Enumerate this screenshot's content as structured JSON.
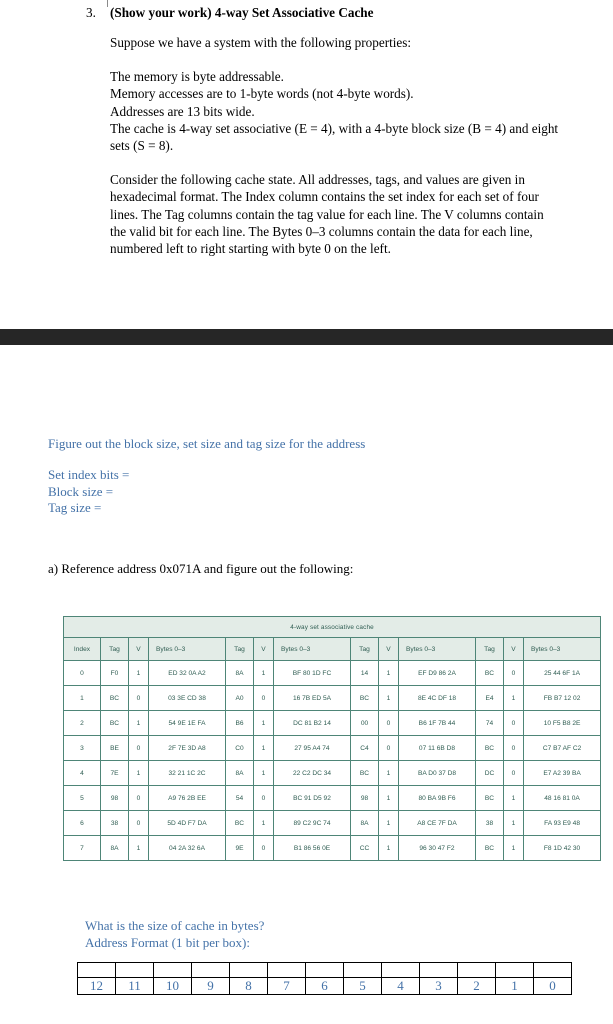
{
  "question": {
    "number": "3.",
    "title": "(Show your work) 4-way Set Associative Cache",
    "paragraphs": [
      "Suppose we have a system with the following properties:",
      "The memory is byte addressable.\nMemory accesses are to 1-byte words (not 4-byte words).\nAddresses are 13 bits wide.\nThe cache is 4-way set associative (E = 4), with a 4-byte block size (B = 4) and eight sets (S = 8).",
      "Consider the following cache state. All addresses, tags, and values are given in hexadecimal format. The Index column contains the set index for each set of four lines. The Tag columns contain the tag value for each line. The V columns contain the valid bit for each line. The Bytes 0–3 columns contain the data for each line, numbered left to right starting with byte 0 on the left."
    ]
  },
  "prompts": {
    "figure_out": "Figure out the block size, set size and tag size for the address",
    "fields": [
      "Set index bits =",
      "Block size =",
      "Tag size ="
    ],
    "part_a": "a) Reference address 0x071A and figure out the following:",
    "cache_size_question": "What is the size of cache in bytes?",
    "address_format_label": "Address Format (1 bit per box):"
  },
  "cache_table": {
    "title": "4-way set associative cache",
    "headers": [
      "Index",
      "Tag",
      "V",
      "Bytes 0–3",
      "Tag",
      "V",
      "Bytes 0–3",
      "Tag",
      "V",
      "Bytes 0–3",
      "Tag",
      "V",
      "Bytes 0–3"
    ],
    "rows": [
      [
        "0",
        "F0",
        "1",
        "ED 32 0A A2",
        "8A",
        "1",
        "BF 80 1D FC",
        "14",
        "1",
        "EF D9 86 2A",
        "BC",
        "0",
        "25 44 6F 1A"
      ],
      [
        "1",
        "BC",
        "0",
        "03 3E CD 38",
        "A0",
        "0",
        "16 7B ED 5A",
        "BC",
        "1",
        "8E 4C DF 18",
        "E4",
        "1",
        "FB B7 12 02"
      ],
      [
        "2",
        "BC",
        "1",
        "54 9E 1E FA",
        "B6",
        "1",
        "DC 81 B2 14",
        "00",
        "0",
        "B6 1F 7B 44",
        "74",
        "0",
        "10 F5 B8 2E"
      ],
      [
        "3",
        "BE",
        "0",
        "2F 7E 3D A8",
        "C0",
        "1",
        "27 95 A4 74",
        "C4",
        "0",
        "07 11 6B D8",
        "BC",
        "0",
        "C7 B7 AF C2"
      ],
      [
        "4",
        "7E",
        "1",
        "32 21 1C 2C",
        "8A",
        "1",
        "22 C2 DC 34",
        "BC",
        "1",
        "BA D0 37 D8",
        "DC",
        "0",
        "E7 A2 39 BA"
      ],
      [
        "5",
        "98",
        "0",
        "A9 76 2B EE",
        "54",
        "0",
        "BC 91 D5 92",
        "98",
        "1",
        "80 BA 9B F6",
        "BC",
        "1",
        "48 16 81 0A"
      ],
      [
        "6",
        "38",
        "0",
        "5D 4D F7 DA",
        "BC",
        "1",
        "89 C2 9C 74",
        "8A",
        "1",
        "A8 CE 7F DA",
        "38",
        "1",
        "FA 93 E9 48"
      ],
      [
        "7",
        "8A",
        "1",
        "04 2A 32 6A",
        "9E",
        "0",
        "B1 86 56 0E",
        "CC",
        "1",
        "96 30 47 F2",
        "BC",
        "1",
        "F8 1D 42 30"
      ]
    ]
  },
  "address_format": {
    "bit_labels": [
      "12",
      "11",
      "10",
      "9",
      "8",
      "7",
      "6",
      "5",
      "4",
      "3",
      "2",
      "1",
      "0"
    ],
    "entries": [
      "",
      "",
      "",
      "",
      "",
      "",
      "",
      "",
      "",
      "",
      "",
      "",
      ""
    ]
  },
  "colors": {
    "blue_text": "#4472a8",
    "table_border": "#4e8577",
    "table_header_bg": "#e3ece7",
    "table_text": "#2f5d52",
    "dark_band": "#262626"
  }
}
